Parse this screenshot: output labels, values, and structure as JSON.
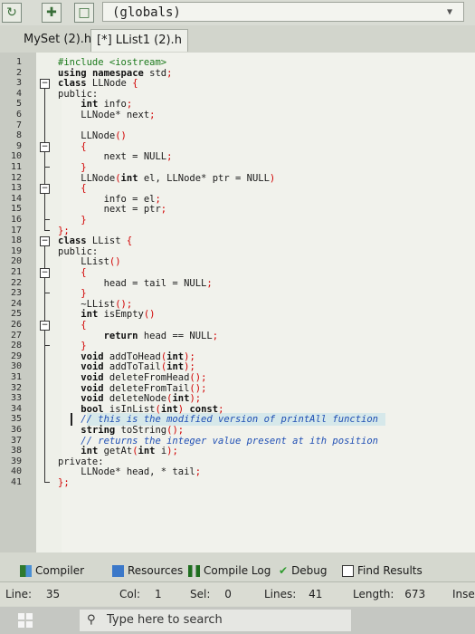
{
  "toolbar": {
    "scope_value": "(globals)"
  },
  "tabs": [
    {
      "label": "MySet (2).h",
      "active": false
    },
    {
      "label": "[*] LList1 (2).h",
      "active": true
    }
  ],
  "code_lines": [
    {
      "n": "1",
      "text": "#include <iostream>"
    },
    {
      "n": "2",
      "text": "using namespace std;"
    },
    {
      "n": "3",
      "text": "class LLNode {"
    },
    {
      "n": "4",
      "text": "public:"
    },
    {
      "n": "5",
      "text": "    int info;"
    },
    {
      "n": "6",
      "text": "    LLNode* next;"
    },
    {
      "n": "7",
      "text": ""
    },
    {
      "n": "8",
      "text": "    LLNode()"
    },
    {
      "n": "9",
      "text": "    {"
    },
    {
      "n": "10",
      "text": "        next = NULL;"
    },
    {
      "n": "11",
      "text": "    }"
    },
    {
      "n": "12",
      "text": "    LLNode(int el, LLNode* ptr = NULL)"
    },
    {
      "n": "13",
      "text": "    {"
    },
    {
      "n": "14",
      "text": "        info = el;"
    },
    {
      "n": "15",
      "text": "        next = ptr;"
    },
    {
      "n": "16",
      "text": "    }"
    },
    {
      "n": "17",
      "text": "};"
    },
    {
      "n": "18",
      "text": "class LList {"
    },
    {
      "n": "19",
      "text": "public:"
    },
    {
      "n": "20",
      "text": "    LList()"
    },
    {
      "n": "21",
      "text": "    {"
    },
    {
      "n": "22",
      "text": "        head = tail = NULL;"
    },
    {
      "n": "23",
      "text": "    }"
    },
    {
      "n": "24",
      "text": "    ~LList();"
    },
    {
      "n": "25",
      "text": "    int isEmpty()"
    },
    {
      "n": "26",
      "text": "    {"
    },
    {
      "n": "27",
      "text": "        return head == NULL;"
    },
    {
      "n": "28",
      "text": "    }"
    },
    {
      "n": "29",
      "text": "    void addToHead(int);"
    },
    {
      "n": "30",
      "text": "    void addToTail(int);"
    },
    {
      "n": "31",
      "text": "    void deleteFromHead();"
    },
    {
      "n": "32",
      "text": "    void deleteFromTail();"
    },
    {
      "n": "33",
      "text": "    void deleteNode(int);"
    },
    {
      "n": "34",
      "text": "    bool isInList(int) const;"
    },
    {
      "n": "35",
      "text": "    // this is the modified version of printAll function"
    },
    {
      "n": "36",
      "text": "    string toString();"
    },
    {
      "n": "37",
      "text": "    // returns the integer value present at ith position"
    },
    {
      "n": "38",
      "text": "    int getAt(int i);"
    },
    {
      "n": "39",
      "text": "private:"
    },
    {
      "n": "40",
      "text": "    LLNode* head, * tail;"
    },
    {
      "n": "41",
      "text": "};"
    }
  ],
  "bottom_tabs": [
    {
      "label": "Compiler",
      "icon": "compiler-icon"
    },
    {
      "label": "Resources",
      "icon": "resources-icon"
    },
    {
      "label": "Compile Log",
      "icon": "compile-log-icon"
    },
    {
      "label": "Debug",
      "icon": "debug-check-icon"
    },
    {
      "label": "Find Results",
      "icon": "find-results-icon"
    }
  ],
  "status": {
    "line_label": "Line:",
    "line_value": "35",
    "col_label": "Col:",
    "col_value": "1",
    "sel_label": "Sel:",
    "sel_value": "0",
    "lines_label": "Lines:",
    "lines_value": "41",
    "length_label": "Length:",
    "length_value": "673",
    "mode": "Inse"
  },
  "taskbar": {
    "search_placeholder": "Type here to search"
  }
}
